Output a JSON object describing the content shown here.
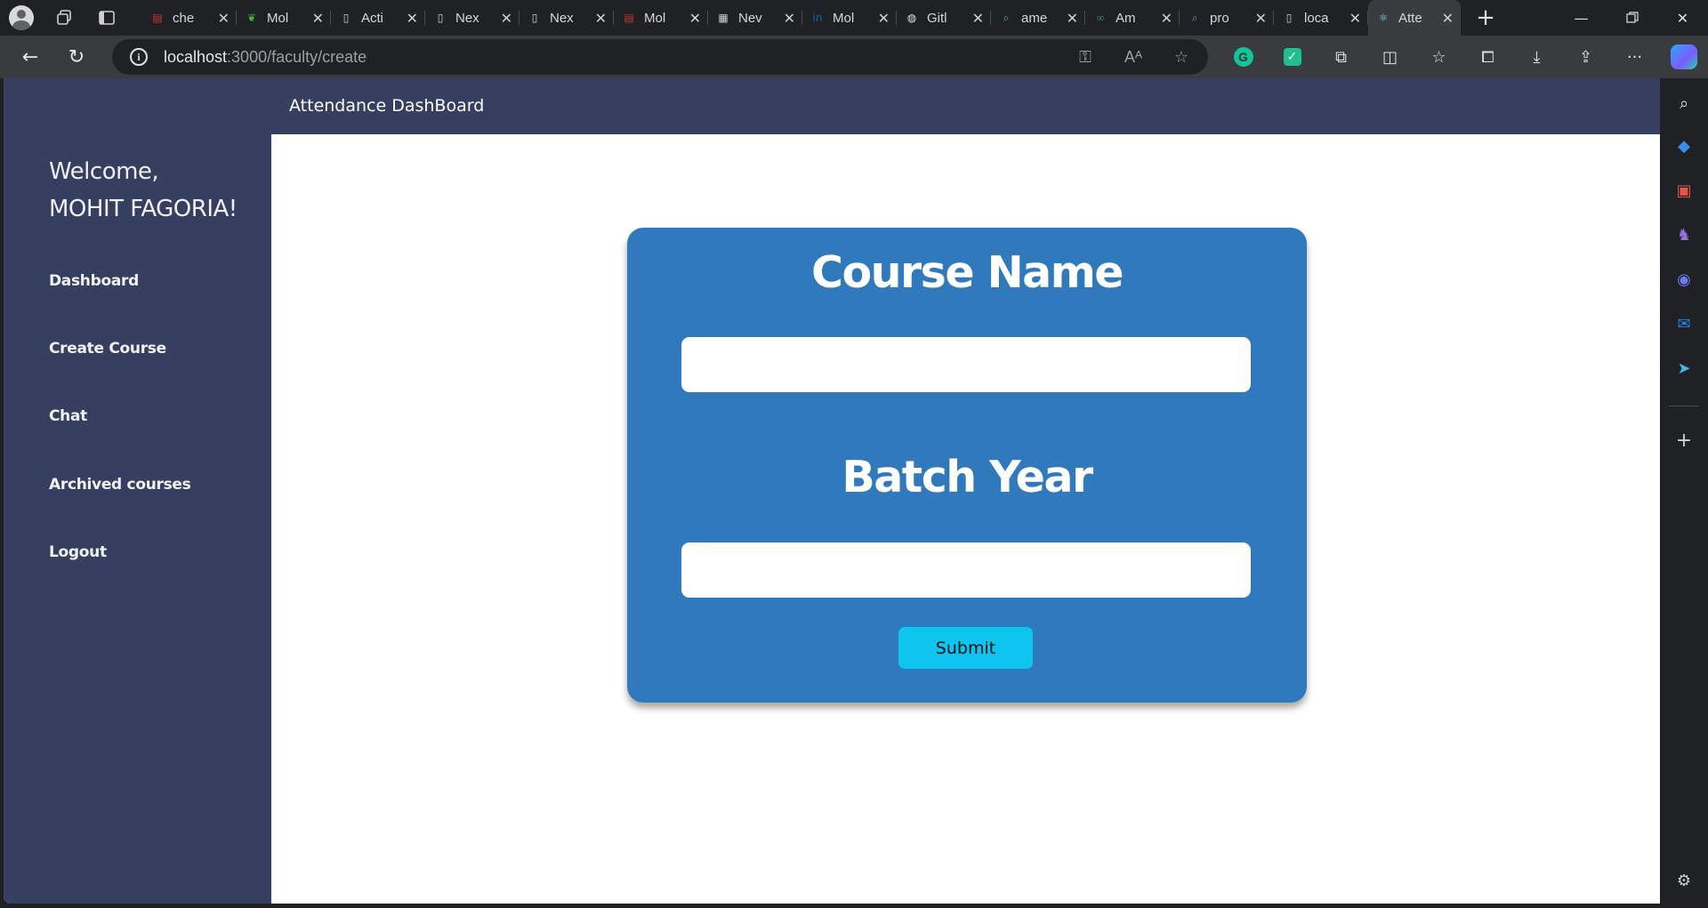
{
  "browser": {
    "tabs": [
      {
        "label": "che",
        "icon": "pdf-icon",
        "color": "#c0392b"
      },
      {
        "label": "Mol",
        "icon": "mongodb-icon",
        "color": "#4db33d"
      },
      {
        "label": "Acti",
        "icon": "page-icon",
        "color": "#cfcfcf"
      },
      {
        "label": "Nex",
        "icon": "page-icon",
        "color": "#cfcfcf"
      },
      {
        "label": "Nex",
        "icon": "page-icon",
        "color": "#cfcfcf"
      },
      {
        "label": "Mol",
        "icon": "pdf-icon",
        "color": "#c0392b"
      },
      {
        "label": "Nev",
        "icon": "calendar-icon",
        "color": "#cfcfcf"
      },
      {
        "label": "Mol",
        "icon": "linkedin-icon",
        "color": "#0a66c2"
      },
      {
        "label": "Gitl",
        "icon": "github-icon",
        "color": "#e0e0e0"
      },
      {
        "label": "ame",
        "icon": "search-icon",
        "color": "#4aa3df"
      },
      {
        "label": "Am",
        "icon": "infinity-icon",
        "color": "#2e8b57"
      },
      {
        "label": "pro",
        "icon": "search-icon",
        "color": "#4aa3df"
      },
      {
        "label": "loca",
        "icon": "page-icon",
        "color": "#cfcfcf"
      },
      {
        "label": "Atte",
        "icon": "react-icon",
        "color": "#61dafb",
        "active": true
      }
    ],
    "url_host": "localhost",
    "url_path": ":3000/faculty/create"
  },
  "app": {
    "header_title": "Attendance DashBoard",
    "welcome_line1": "Welcome,",
    "welcome_line2": "MOHIT FAGORIA!",
    "nav": [
      {
        "label": "Dashboard"
      },
      {
        "label": "Create Course"
      },
      {
        "label": "Chat"
      },
      {
        "label": "Archived courses"
      },
      {
        "label": "Logout"
      }
    ]
  },
  "form": {
    "course_name_label": "Course Name",
    "course_name_value": "",
    "batch_year_label": "Batch Year",
    "batch_year_value": "",
    "submit_label": "Submit"
  },
  "colors": {
    "sidebar": "#373f61",
    "card": "#2f79bc",
    "submit": "#0ec5ef"
  }
}
